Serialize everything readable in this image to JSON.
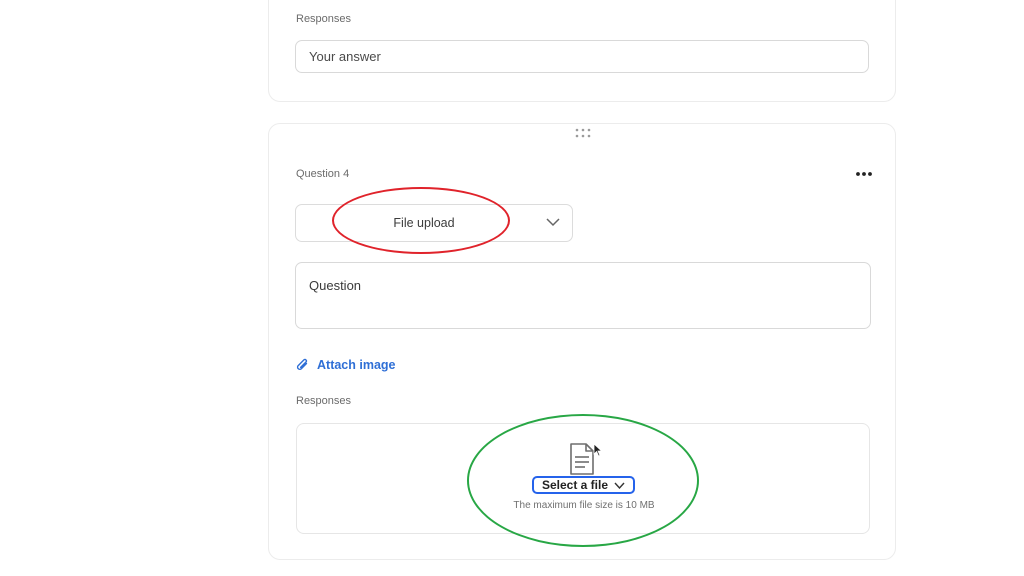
{
  "previous_question": {
    "responses_label": "Responses",
    "answer_placeholder": "Your answer"
  },
  "question4": {
    "number_label": "Question 4",
    "type_select_value": "File upload",
    "question_placeholder": "Question",
    "attach_image_label": "Attach image",
    "responses_label": "Responses",
    "upload": {
      "select_file_label": "Select a file",
      "max_size_text": "The maximum file size is 10 MB"
    }
  },
  "colors": {
    "accent_blue": "#2f6fd6",
    "annotation_red": "#e0232b",
    "annotation_green": "#28a745"
  },
  "icons": [
    "drag-handle-icon",
    "more-options-icon",
    "chevron-down-icon",
    "paperclip-icon",
    "document-icon",
    "mouse-pointer-icon"
  ]
}
